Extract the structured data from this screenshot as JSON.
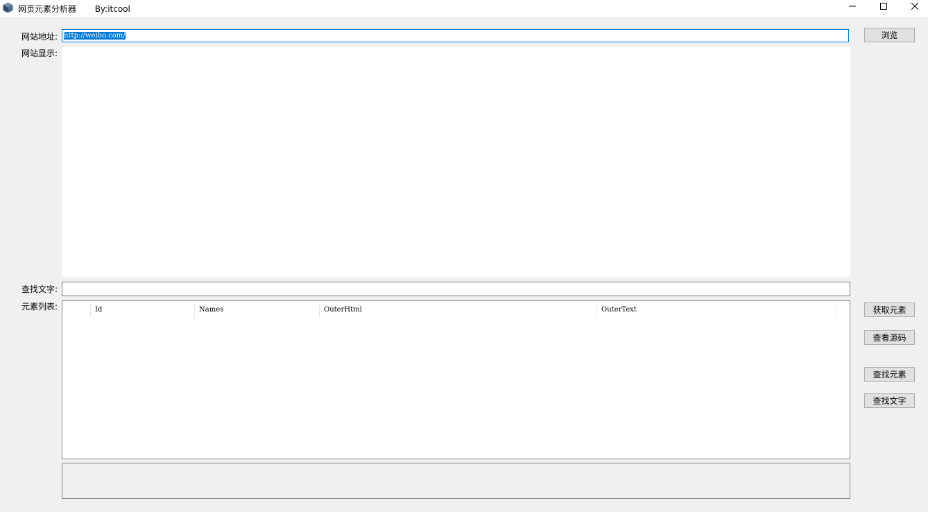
{
  "window": {
    "title": "网页元素分析器       By:itcool",
    "controls": {
      "minimize": "minimize-icon",
      "maximize": "maximize-icon",
      "close": "close-icon"
    }
  },
  "labels": {
    "url": "网站地址:",
    "display": "网站显示:",
    "find_text": "查找文字:",
    "element_list": "元素列表:"
  },
  "url_input": {
    "value": "http://weibo.com/"
  },
  "find_input": {
    "value": ""
  },
  "grid": {
    "columns": [
      "",
      "Id",
      "Names",
      "OuterHtml",
      "OuterText"
    ]
  },
  "buttons": {
    "browse": "浏览",
    "get_elements": "获取元素",
    "view_source": "查看源码",
    "find_element": "查找元素",
    "find_text": "查找文字"
  }
}
